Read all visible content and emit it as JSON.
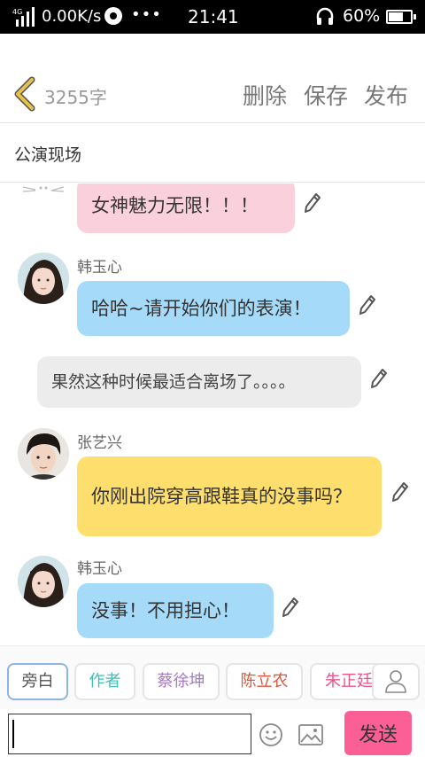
{
  "status_bar": {
    "network": "4G",
    "speed": "0.00K/s",
    "more": "•••",
    "time": "21:41",
    "battery": "60%"
  },
  "header": {
    "word_count": "3255字",
    "delete_label": "删除",
    "save_label": "保存",
    "publish_label": "发布"
  },
  "scene": {
    "title": "公演现场"
  },
  "messages": [
    {
      "speaker": "",
      "text": "女神魅力无限！！！",
      "style": "pink"
    },
    {
      "speaker": "韩玉心",
      "text": "哈哈~请开始你们的表演！",
      "style": "blue"
    },
    {
      "speaker": "",
      "text": "果然这种时候最适合离场了。。。。",
      "style": "narration"
    },
    {
      "speaker": "张艺兴",
      "text": "你刚出院穿高跟鞋真的没事吗？",
      "style": "yellow"
    },
    {
      "speaker": "韩玉心",
      "text": "没事！不用担心！",
      "style": "blue"
    }
  ],
  "characters": [
    {
      "label": "旁白",
      "color": "#555555"
    },
    {
      "label": "作者",
      "color": "#3cc0b8"
    },
    {
      "label": "蔡徐坤",
      "color": "#a678c8"
    },
    {
      "label": "陈立农",
      "color": "#e2553d"
    },
    {
      "label": "朱正廷",
      "color": "#e8568c"
    }
  ],
  "input": {
    "value": "",
    "send_label": "发送"
  },
  "colors": {
    "pink_bubble": "#fbd0dd",
    "blue_bubble": "#a5dbf8",
    "yellow_bubble": "#fedf6d",
    "gray_bubble": "#ececec",
    "send_button": "#fb5f95",
    "back_arrow": "#e8c24a"
  }
}
